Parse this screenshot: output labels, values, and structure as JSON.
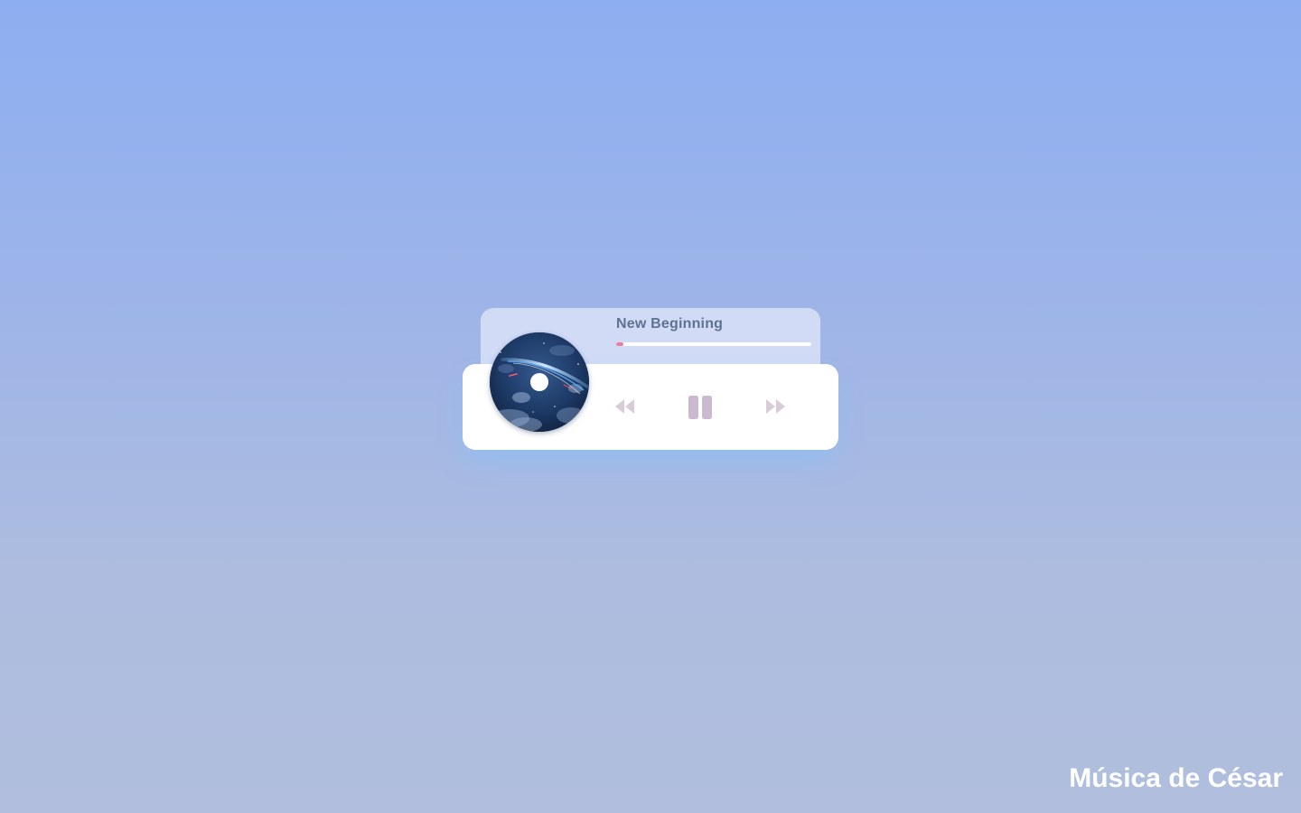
{
  "player": {
    "track_title": "New Beginning",
    "progress_fraction": 0.035,
    "state": "playing",
    "album_art": "night-sky-comet-art",
    "controls": [
      {
        "name": "rewind-button",
        "icon": "rewind-icon"
      },
      {
        "name": "pause-button",
        "icon": "pause-icon"
      },
      {
        "name": "fast-forward-button",
        "icon": "fast-forward-icon"
      }
    ]
  },
  "footer": {
    "brand": "Música de César"
  },
  "colors": {
    "background_top": "#8daef1",
    "background_bottom": "#b1bedd",
    "info_panel": "#d1dbf6",
    "control_panel": "#ffffff",
    "title_text": "#5f7391",
    "progress_fill": "#f07b9a",
    "controls_icon": "#d9ccd9",
    "pause_icon": "#cbb9d0"
  }
}
